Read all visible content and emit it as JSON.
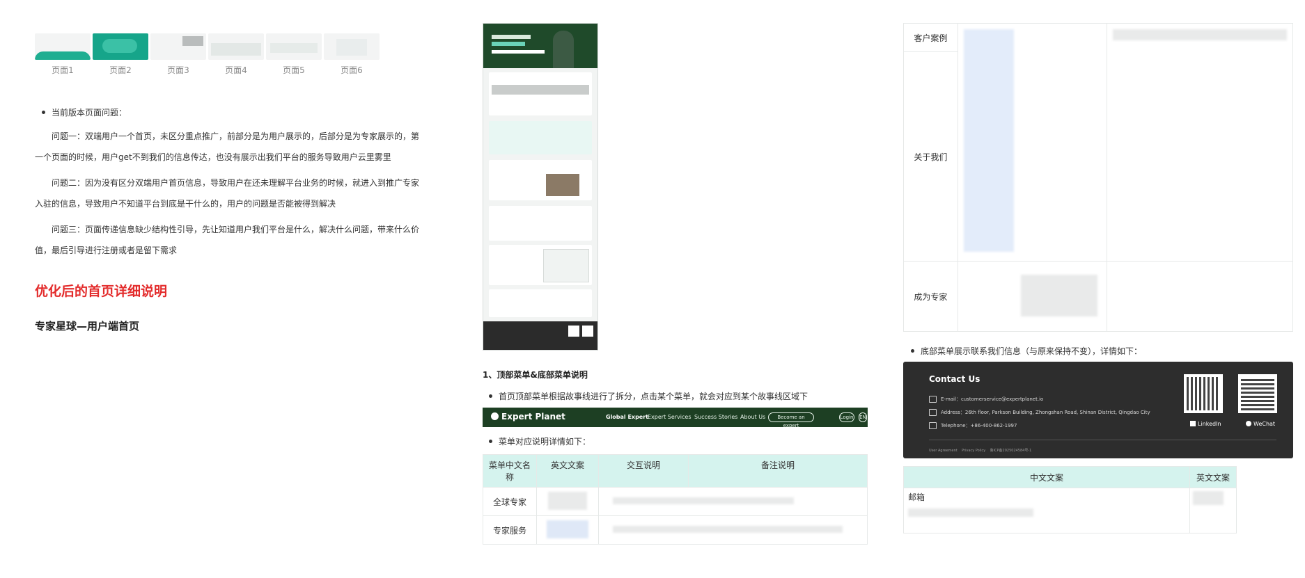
{
  "thumbnails": [
    "页面1",
    "页面2",
    "页面3",
    "页面4",
    "页面5",
    "页面6"
  ],
  "issues": {
    "heading": "当前版本页面问题：",
    "items": [
      "问题一：双端用户一个首页，未区分重点推广，前部分是为用户展示的，后部分是为专家展示的，第一个页面的时候，用户get不到我们的信息传达，也没有展示出我们平台的服务导致用户云里雾里",
      "问题二：因为没有区分双端用户首页信息，导致用户在还未理解平台业务的时候，就进入到推广专家入驻的信息，导致用户不知道平台到底是干什么的，用户的问题是否能被得到解决",
      "问题三：页面传递信息缺少结构性引导，先让知道用户我们平台是什么，解决什么问题，带来什么价值，最后引导进行注册或者是留下需求"
    ]
  },
  "optimized_title": "优化后的首页详细说明",
  "page_subtitle": "专家星球—用户端首页",
  "menu_section": {
    "title": "1、顶部菜单&底部菜单说明",
    "bullet1": "首页顶部菜单根据故事线进行了拆分，点击某个菜单，就会对应到某个故事线区域下",
    "bullet2": "菜单对应说明详情如下："
  },
  "menubar": {
    "logo": "Expert Planet",
    "items": [
      "Global Expert",
      "Expert Services",
      "Success Stories",
      "About Us"
    ],
    "become": "Become an expert",
    "login": "Login",
    "lang": "EN"
  },
  "menu_table": {
    "headers": [
      "菜单中文名称",
      "英文文案",
      "交互说明",
      "备注说明"
    ],
    "rows": [
      "全球专家",
      "专家服务"
    ]
  },
  "case_table": {
    "rows": [
      "客户案例",
      "关于我们",
      "成为专家"
    ]
  },
  "footer_note": "底部菜单展示联系我们信息（与原来保持不变），详情如下：",
  "contact": {
    "title": "Contact Us",
    "email": "E-mail：customerservice@expertplanet.io",
    "address": "Address：26th floor, Parkson Building, Zhongshan Road, Shinan District, Qingdao City",
    "telephone": "Telephone：+86-400-862-1997",
    "linkedin": "LinkedIn",
    "wechat": "WeChat",
    "links": [
      "User Agreement",
      "Privacy Policy",
      "鲁ICP备2025024584号-1"
    ]
  },
  "lang_table": {
    "headers": [
      "中文文案",
      "英文文案"
    ],
    "cell": "邮箱"
  },
  "colors": {
    "red": "#e32b2b",
    "mint": "#d5f3ee",
    "dark_green": "#1d3f23",
    "dark_footer": "#2d2d2d"
  }
}
